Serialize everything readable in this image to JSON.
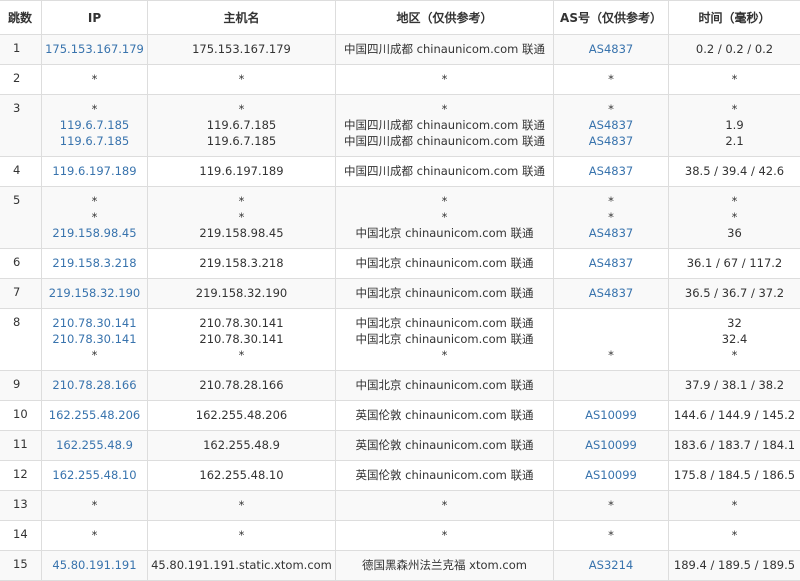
{
  "columns": [
    "跳数",
    "IP",
    "主机名",
    "地区（仅供参考）",
    "AS号（仅供参考）",
    "时间（毫秒）"
  ],
  "colors": {
    "link": "#3873ad",
    "text": "#333333",
    "stripe": "#f9f9f9",
    "border": "#dddddd"
  },
  "hops": [
    {
      "hop": "1",
      "lines": [
        {
          "ip": "175.153.167.179",
          "host": "175.153.167.179",
          "region": "中国四川成都 chinaunicom.com 联通",
          "as": "AS4837",
          "time": "0.2 / 0.2 / 0.2"
        }
      ]
    },
    {
      "hop": "2",
      "lines": [
        {
          "ip": "*",
          "host": "*",
          "region": "*",
          "as": "*",
          "time": "*"
        }
      ]
    },
    {
      "hop": "3",
      "lines": [
        {
          "ip": "*",
          "host": "*",
          "region": "*",
          "as": "*",
          "time": "*"
        },
        {
          "ip": "119.6.7.185",
          "host": "119.6.7.185",
          "region": "中国四川成都 chinaunicom.com 联通",
          "as": "AS4837",
          "time": "1.9"
        },
        {
          "ip": "119.6.7.185",
          "host": "119.6.7.185",
          "region": "中国四川成都 chinaunicom.com 联通",
          "as": "AS4837",
          "time": "2.1"
        }
      ]
    },
    {
      "hop": "4",
      "lines": [
        {
          "ip": "119.6.197.189",
          "host": "119.6.197.189",
          "region": "中国四川成都 chinaunicom.com 联通",
          "as": "AS4837",
          "time": "38.5 / 39.4 / 42.6"
        }
      ]
    },
    {
      "hop": "5",
      "lines": [
        {
          "ip": "*",
          "host": "*",
          "region": "*",
          "as": "*",
          "time": "*"
        },
        {
          "ip": "*",
          "host": "*",
          "region": "*",
          "as": "*",
          "time": "*"
        },
        {
          "ip": "219.158.98.45",
          "host": "219.158.98.45",
          "region": "中国北京 chinaunicom.com 联通",
          "as": "AS4837",
          "time": "36"
        }
      ]
    },
    {
      "hop": "6",
      "lines": [
        {
          "ip": "219.158.3.218",
          "host": "219.158.3.218",
          "region": "中国北京 chinaunicom.com 联通",
          "as": "AS4837",
          "time": "36.1 / 67 / 117.2"
        }
      ]
    },
    {
      "hop": "7",
      "lines": [
        {
          "ip": "219.158.32.190",
          "host": "219.158.32.190",
          "region": "中国北京 chinaunicom.com 联通",
          "as": "AS4837",
          "time": "36.5 / 36.7 / 37.2"
        }
      ]
    },
    {
      "hop": "8",
      "lines": [
        {
          "ip": "210.78.30.141",
          "host": "210.78.30.141",
          "region": "中国北京 chinaunicom.com 联通",
          "as": "",
          "time": "32"
        },
        {
          "ip": "210.78.30.141",
          "host": "210.78.30.141",
          "region": "中国北京 chinaunicom.com 联通",
          "as": "",
          "time": "32.4"
        },
        {
          "ip": "*",
          "host": "*",
          "region": "*",
          "as": "*",
          "time": "*"
        }
      ]
    },
    {
      "hop": "9",
      "lines": [
        {
          "ip": "210.78.28.166",
          "host": "210.78.28.166",
          "region": "中国北京 chinaunicom.com 联通",
          "as": "",
          "time": "37.9 / 38.1 / 38.2"
        }
      ]
    },
    {
      "hop": "10",
      "lines": [
        {
          "ip": "162.255.48.206",
          "host": "162.255.48.206",
          "region": "英国伦敦 chinaunicom.com 联通",
          "as": "AS10099",
          "time": "144.6 / 144.9 / 145.2"
        }
      ]
    },
    {
      "hop": "11",
      "lines": [
        {
          "ip": "162.255.48.9",
          "host": "162.255.48.9",
          "region": "英国伦敦 chinaunicom.com 联通",
          "as": "AS10099",
          "time": "183.6 / 183.7 / 184.1"
        }
      ]
    },
    {
      "hop": "12",
      "lines": [
        {
          "ip": "162.255.48.10",
          "host": "162.255.48.10",
          "region": "英国伦敦 chinaunicom.com 联通",
          "as": "AS10099",
          "time": "175.8 / 184.5 / 186.5"
        }
      ]
    },
    {
      "hop": "13",
      "lines": [
        {
          "ip": "*",
          "host": "*",
          "region": "*",
          "as": "*",
          "time": "*"
        }
      ]
    },
    {
      "hop": "14",
      "lines": [
        {
          "ip": "*",
          "host": "*",
          "region": "*",
          "as": "*",
          "time": "*"
        }
      ]
    },
    {
      "hop": "15",
      "lines": [
        {
          "ip": "45.80.191.191",
          "host": "45.80.191.191.static.xtom.com",
          "region": "德国黑森州法兰克福 xtom.com",
          "as": "AS3214",
          "time": "189.4 / 189.5 / 189.5"
        }
      ]
    }
  ]
}
